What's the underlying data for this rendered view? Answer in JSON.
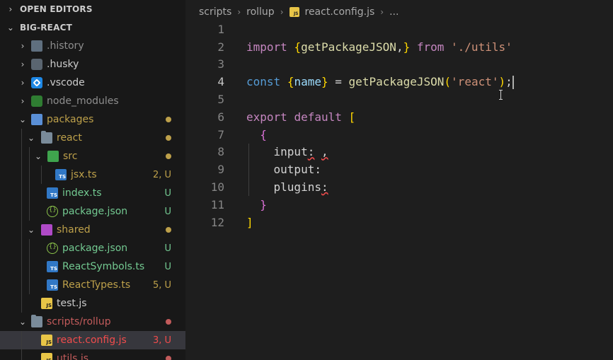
{
  "sidebar": {
    "open_editors": {
      "label": "OPEN EDITORS",
      "chevron": "›"
    },
    "project": {
      "label": "BIG-REACT",
      "chevron": "⌄"
    },
    "items": [
      {
        "label": ".history",
        "twisty": "›"
      },
      {
        "label": ".husky",
        "twisty": "›"
      },
      {
        "label": ".vscode",
        "twisty": "›"
      },
      {
        "label": "node_modules",
        "twisty": "›"
      },
      {
        "label": "packages",
        "twisty": "⌄"
      },
      {
        "label": "react",
        "twisty": "⌄"
      },
      {
        "label": "src",
        "twisty": "⌄"
      },
      {
        "label": "jsx.ts",
        "icon_text": "TS",
        "decoration": "2, U"
      },
      {
        "label": "index.ts",
        "icon_text": "TS",
        "decoration": "U"
      },
      {
        "label": "package.json",
        "decoration": "U"
      },
      {
        "label": "shared",
        "twisty": "⌄"
      },
      {
        "label": "package.json",
        "decoration": "U"
      },
      {
        "label": "ReactSymbols.ts",
        "icon_text": "TS",
        "decoration": "U"
      },
      {
        "label": "ReactTypes.ts",
        "icon_text": "TS",
        "decoration": "5, U"
      },
      {
        "label": "test.js",
        "icon_text": "JS"
      },
      {
        "label": "scripts/rollup",
        "twisty": "⌄"
      },
      {
        "label": "react.config.js",
        "icon_text": "JS",
        "decoration": "3, U"
      },
      {
        "label": "utils.js",
        "icon_text": "JS"
      }
    ],
    "colors": {
      "untracked": "#73c991",
      "modified_dot": "#bda04a",
      "error": "#f14c4c",
      "error_dot": "#c25b5b"
    }
  },
  "breadcrumb": {
    "parts": [
      "scripts",
      "rollup",
      "react.config.js",
      "..."
    ],
    "separator": "›",
    "js_badge": "JS"
  },
  "editor": {
    "line_numbers": [
      "1",
      "2",
      "3",
      "4",
      "5",
      "6",
      "7",
      "8",
      "9",
      "10",
      "11",
      "12"
    ],
    "line2": {
      "kw_import": "import",
      "ob": "{",
      "fn": "getPackageJSON",
      "comma": ",",
      "cb": "}",
      "kw_from": "from",
      "str": "'./utils'"
    },
    "line4": {
      "kw_const": "const",
      "ob": "{",
      "var": "name",
      "cb": "}",
      "eq": "=",
      "fn": "getPackageJSON",
      "op": "(",
      "str": "'react'",
      "cp": ")",
      "semi": ";"
    },
    "line6": {
      "kw_export": "export",
      "kw_default": "default",
      "ob": "["
    },
    "line7": {
      "ob": "{"
    },
    "line8": {
      "key": "input",
      "colon": ":",
      "comma": ","
    },
    "line9": {
      "key": "output",
      "colon": ":"
    },
    "line10": {
      "key": "plugins",
      "colon": ":"
    },
    "line11": {
      "cb": "}"
    },
    "line12": {
      "cb": "]"
    }
  }
}
